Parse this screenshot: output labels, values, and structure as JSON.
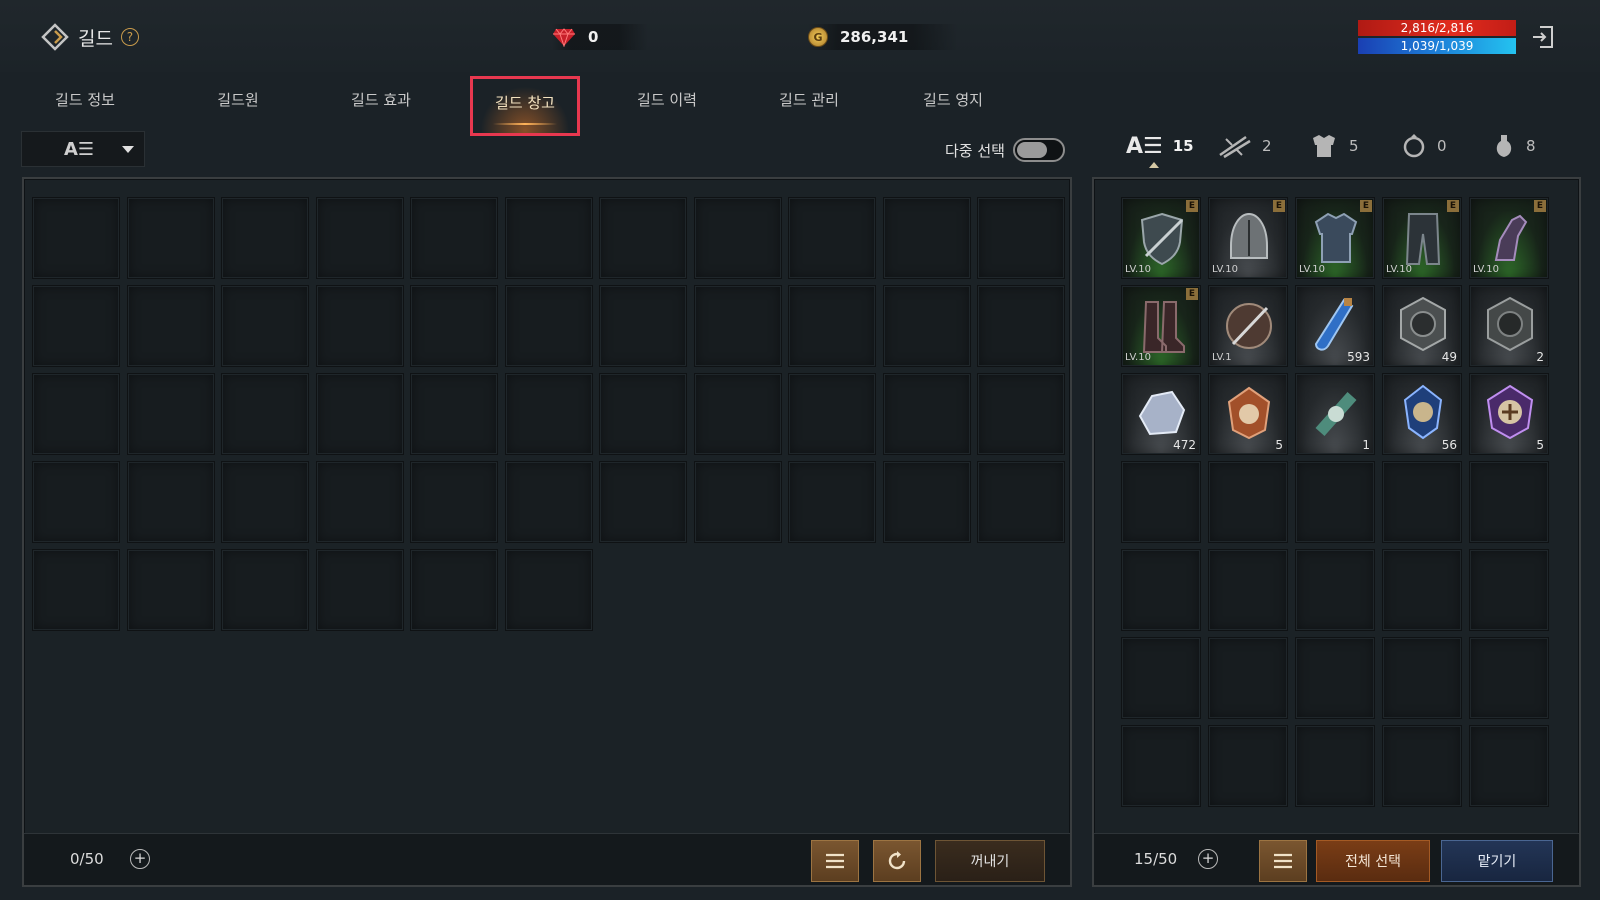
{
  "header": {
    "title": "길드",
    "help_glyph": "?",
    "gems": "0",
    "gold": "286,341",
    "coin_glyph": "G",
    "hp": "2,816/2,816",
    "mp": "1,039/1,039"
  },
  "tabs": [
    {
      "label": "길드 정보",
      "active": false
    },
    {
      "label": "길드원",
      "active": false
    },
    {
      "label": "길드 효과",
      "active": false
    },
    {
      "label": "길드 창고",
      "active": true
    },
    {
      "label": "길드 이력",
      "active": false
    },
    {
      "label": "길드 관리",
      "active": false
    },
    {
      "label": "길드 영지",
      "active": false
    }
  ],
  "filter": {
    "sort_glyph": "A☰"
  },
  "multi_select": {
    "label": "다중 선택",
    "on": false
  },
  "storage": {
    "capacity": "0/50",
    "withdraw_label": "꺼내기"
  },
  "inventory": {
    "categories": [
      {
        "icon": "all-items-icon",
        "glyph": "A☰",
        "count": "15",
        "active": true
      },
      {
        "icon": "weapon-icon",
        "count": "2",
        "active": false
      },
      {
        "icon": "armor-icon",
        "count": "5",
        "active": false
      },
      {
        "icon": "accessory-icon",
        "count": "0",
        "active": false
      },
      {
        "icon": "consumable-icon",
        "count": "8",
        "active": false
      }
    ],
    "items": [
      {
        "icon": "shield-sword-icon",
        "level": "LV.10",
        "badge": "E",
        "grade": "green"
      },
      {
        "icon": "helmet-icon",
        "level": "LV.10",
        "badge": "E",
        "grade": "gray"
      },
      {
        "icon": "body-armor-icon",
        "level": "LV.10",
        "badge": "E",
        "grade": "green"
      },
      {
        "icon": "pants-icon",
        "level": "LV.10",
        "badge": "E",
        "grade": "green"
      },
      {
        "icon": "gauntlet-icon",
        "level": "LV.10",
        "badge": "E",
        "grade": "green"
      },
      {
        "icon": "boots-icon",
        "level": "LV.10",
        "badge": "E",
        "grade": "green"
      },
      {
        "icon": "sword-shield-icon",
        "level": "LV.1",
        "grade": "gray"
      },
      {
        "icon": "potion-icon",
        "qty": "593",
        "grade": "gray"
      },
      {
        "icon": "wolf-emblem-icon",
        "qty": "49",
        "grade": "gray"
      },
      {
        "icon": "bear-emblem-icon",
        "qty": "2",
        "grade": "gray"
      },
      {
        "icon": "crystal-ore-icon",
        "qty": "472",
        "grade": "gray"
      },
      {
        "icon": "compass-stone-icon",
        "qty": "5",
        "grade": "gray"
      },
      {
        "icon": "scroll-icon",
        "qty": "1",
        "grade": "gray"
      },
      {
        "icon": "blue-gem-icon",
        "qty": "56",
        "grade": "gray"
      },
      {
        "icon": "purple-cross-gem-icon",
        "qty": "5",
        "grade": "gray"
      }
    ],
    "capacity": "15/50",
    "select_all_label": "전체 선택",
    "deposit_label": "맡기기"
  },
  "colors": {
    "active_tab_border": "#e8384f",
    "hp": "#e12c1e",
    "mp": "#1d7fd8",
    "select_all": "#7a3d16",
    "deposit": "#233556"
  }
}
